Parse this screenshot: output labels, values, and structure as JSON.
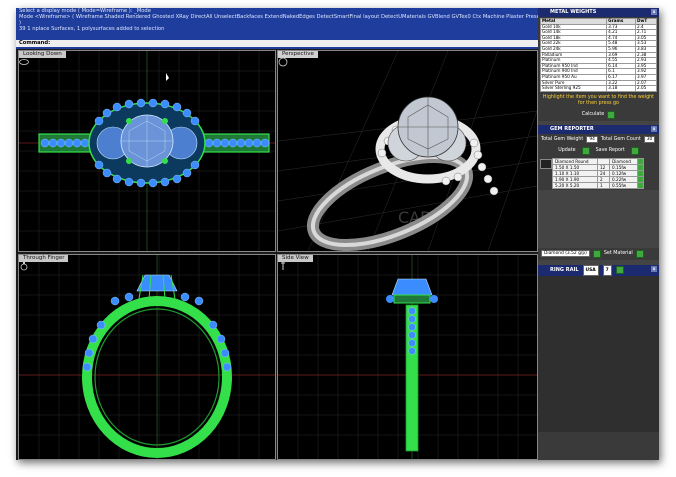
{
  "command": {
    "lines": [
      "Select a display mode ( Mode=Wireframe ):  _Mode",
      "Mode <Wireframe> ( Wireframe  Shaded  Rendered  Ghosted  XRay  DirectAll  UnselectBackfaces  ExtendNakedEdges  DetectSmartFinal layout  DetectUMaterials  GVBlend  GVTex0  Ctx  Machine  Plaster  Presentation ):",
      "  )",
      "39 1 nplace Surfaces, 1 polysurfaces added to selection"
    ],
    "prompt": "Command:"
  },
  "viewports": {
    "top_left": "Looking Down",
    "top_right": "Perspective",
    "bottom_left": "Through Finger",
    "bottom_right": "Side View"
  },
  "metal_weights": {
    "title": "METAL WEIGHTS",
    "headers": [
      "Metal",
      "Grams",
      "DwT"
    ],
    "rows": [
      [
        "Gold 10k",
        "3.73",
        "2.4"
      ],
      [
        "Gold 14k",
        "4.21",
        "2.71"
      ],
      [
        "Gold 18k",
        "4.74",
        "3.05"
      ],
      [
        "Gold 22k",
        "5.48",
        "3.53"
      ],
      [
        "Gold 24k",
        "5.96",
        "3.83"
      ],
      [
        "Palladium",
        "3.69",
        "2.38"
      ],
      [
        "Platinum",
        "4.55",
        "2.93"
      ],
      [
        "Platinum 950 Ind",
        "6.14",
        "3.95"
      ],
      [
        "Platinum 900 Ind",
        "6.1",
        "3.92"
      ],
      [
        "Platinum 950 Au",
        "6.17",
        "3.97"
      ],
      [
        "Silver Pure",
        "3.22",
        "2.07"
      ],
      [
        "Silver Sterling 925",
        "3.18",
        "2.05"
      ]
    ],
    "hint": "Highlight the item you want to find the weight for then press go",
    "calculate_label": "Calculate"
  },
  "gem_reporter": {
    "title": "GEM REPORTER",
    "total_weight_label": "Total Gem Weight",
    "total_weight_value": "94",
    "total_count_label": "Total Gem Count",
    "total_count_value": "30",
    "update_label": "Update",
    "save_report_label": "Save Report",
    "gem_headers": [
      "Diamond Round",
      "Diamond"
    ],
    "gems": [
      [
        "1.50 X 1.50",
        "12",
        "0.15fw"
      ],
      [
        "1.10 X 1.10",
        "24",
        "0.12fw"
      ],
      [
        "1.90 X 1.90",
        "2",
        "0.22fw"
      ],
      [
        "5.20 X 5.20",
        "1",
        "0.55fw"
      ]
    ],
    "material_value": "Diamond  (3.52 g/p)",
    "set_material_label": "Set Material"
  },
  "ring_rail": {
    "title": "RING RAIL",
    "select_value": "USA",
    "size_value": "7"
  },
  "colors": {
    "command_bg": "#1e3d9c",
    "panel_header": "#1c2a70",
    "wire_blue": "#3a8cff",
    "wire_green": "#34e04a",
    "highlight_yellow": "#ffd23a"
  }
}
